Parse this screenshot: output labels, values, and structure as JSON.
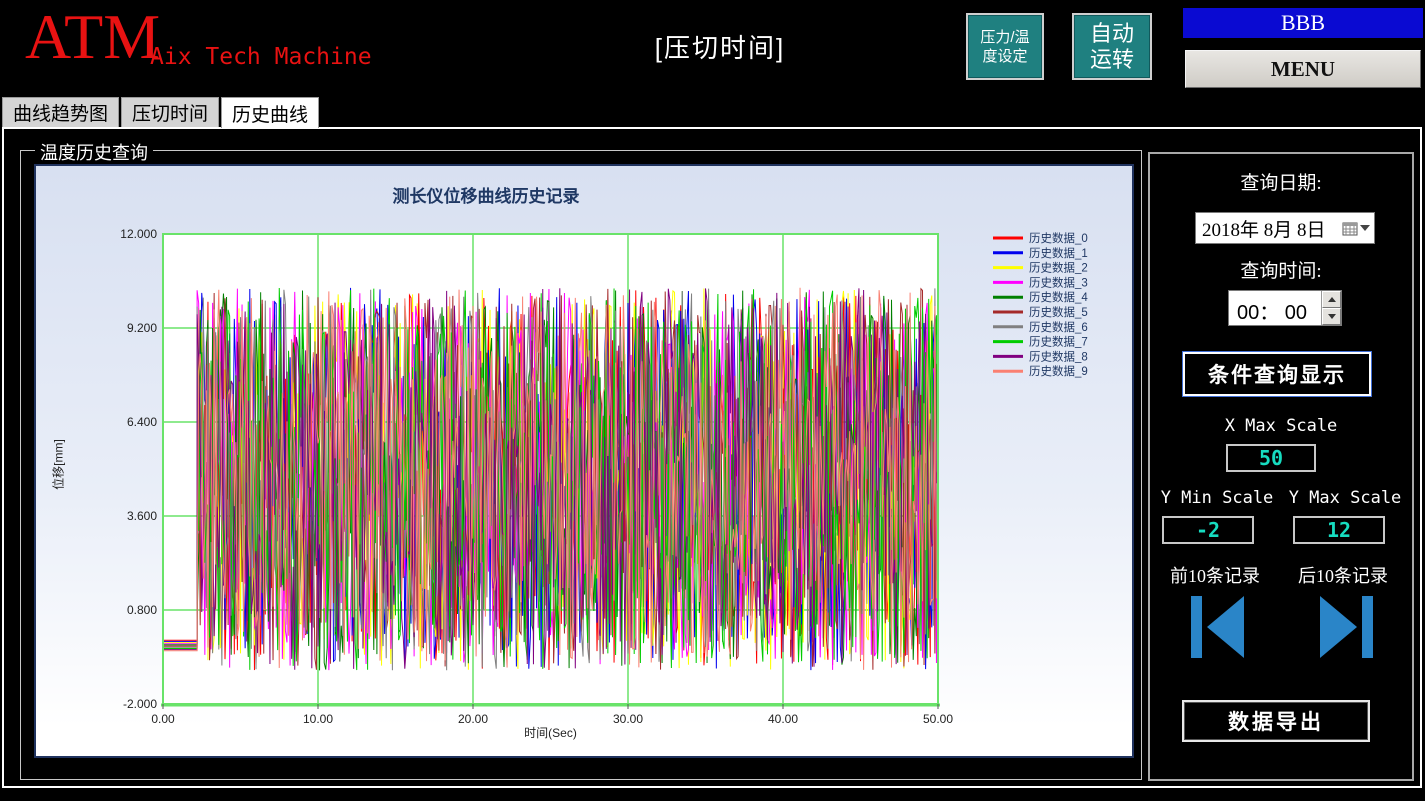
{
  "header": {
    "logo": "ATM",
    "logo_sub": "Aix Tech Machine",
    "title": "[压切时间]",
    "pressure_btn_line1": "压力/温",
    "pressure_btn_line2": "度设定",
    "auto_btn_line1": "自动",
    "auto_btn_line2": "运转",
    "bbb": "BBB",
    "menu": "MENU",
    "logo_color": "#e81212",
    "teal_color": "#1f8080",
    "bbb_color": "#0a0ad2"
  },
  "tabs": [
    {
      "label": "曲线趋势图",
      "active": false
    },
    {
      "label": "压切时间",
      "active": false
    },
    {
      "label": "历史曲线",
      "active": true
    }
  ],
  "groupbox_label": "温度历史查询",
  "chart_data": {
    "type": "line",
    "title": "测长仪位移曲线历史记录",
    "xlabel": "时间(Sec)",
    "ylabel": "位移[mm]",
    "xlim": [
      0,
      50
    ],
    "ylim": [
      -2,
      12
    ],
    "x_ticks": [
      {
        "value": 0,
        "label": "0.00"
      },
      {
        "value": 10,
        "label": "10.00"
      },
      {
        "value": 20,
        "label": "20.00"
      },
      {
        "value": 30,
        "label": "30.00"
      },
      {
        "value": 40,
        "label": "40.00"
      },
      {
        "value": 50,
        "label": "50.00"
      }
    ],
    "y_ticks": [
      {
        "value": 12,
        "label": "12.000"
      },
      {
        "value": 9.2,
        "label": "9.200"
      },
      {
        "value": 6.4,
        "label": "6.400"
      },
      {
        "value": 3.6,
        "label": "3.600"
      },
      {
        "value": 0.8,
        "label": "0.800"
      },
      {
        "value": -2,
        "label": "-2.000"
      }
    ],
    "grid": true,
    "grid_color": "#69e369",
    "plot_bg": "#ffffff",
    "legend_position": "right-top",
    "legend_text_color": "#203864",
    "series": [
      {
        "name": "历史数据_0",
        "color": "#ff0000",
        "seed": 101
      },
      {
        "name": "历史数据_1",
        "color": "#0000ee",
        "seed": 102
      },
      {
        "name": "历史数据_2",
        "color": "#ffff00",
        "seed": 103
      },
      {
        "name": "历史数据_3",
        "color": "#ff00ff",
        "seed": 104
      },
      {
        "name": "历史数据_4",
        "color": "#008000",
        "seed": 105
      },
      {
        "name": "历史数据_5",
        "color": "#a52a2a",
        "seed": 106
      },
      {
        "name": "历史数据_6",
        "color": "#808080",
        "seed": 107
      },
      {
        "name": "历史数据_7",
        "color": "#00cc00",
        "seed": 108
      },
      {
        "name": "历史数据_8",
        "color": "#800080",
        "seed": 109
      },
      {
        "name": "历史数据_9",
        "color": "#fa8072",
        "seed": 110
      }
    ],
    "noise_model": {
      "flat_until_x": 2.2,
      "flat_base_value": -0.1,
      "flat_series_offset": -0.035,
      "x_step": 0.1,
      "y_min": -1.0,
      "y_max": 10.4
    }
  },
  "query_panel": {
    "date_label": "查询日期:",
    "date_value": "2018年 8月 8日",
    "time_label": "查询时间:",
    "time_value": "00： 00",
    "query_button": "条件查询显示",
    "x_max_label": "X Max Scale",
    "x_max_value": "50",
    "y_min_label": "Y Min Scale",
    "y_min_value": "-2",
    "y_max_label": "Y Max Scale",
    "y_max_value": "12",
    "prev_label": "前10条记录",
    "next_label": "后10条记录",
    "export_button": "数据导出",
    "value_color": "#16dcc0",
    "skip_icon_color": "#2a85c8"
  }
}
